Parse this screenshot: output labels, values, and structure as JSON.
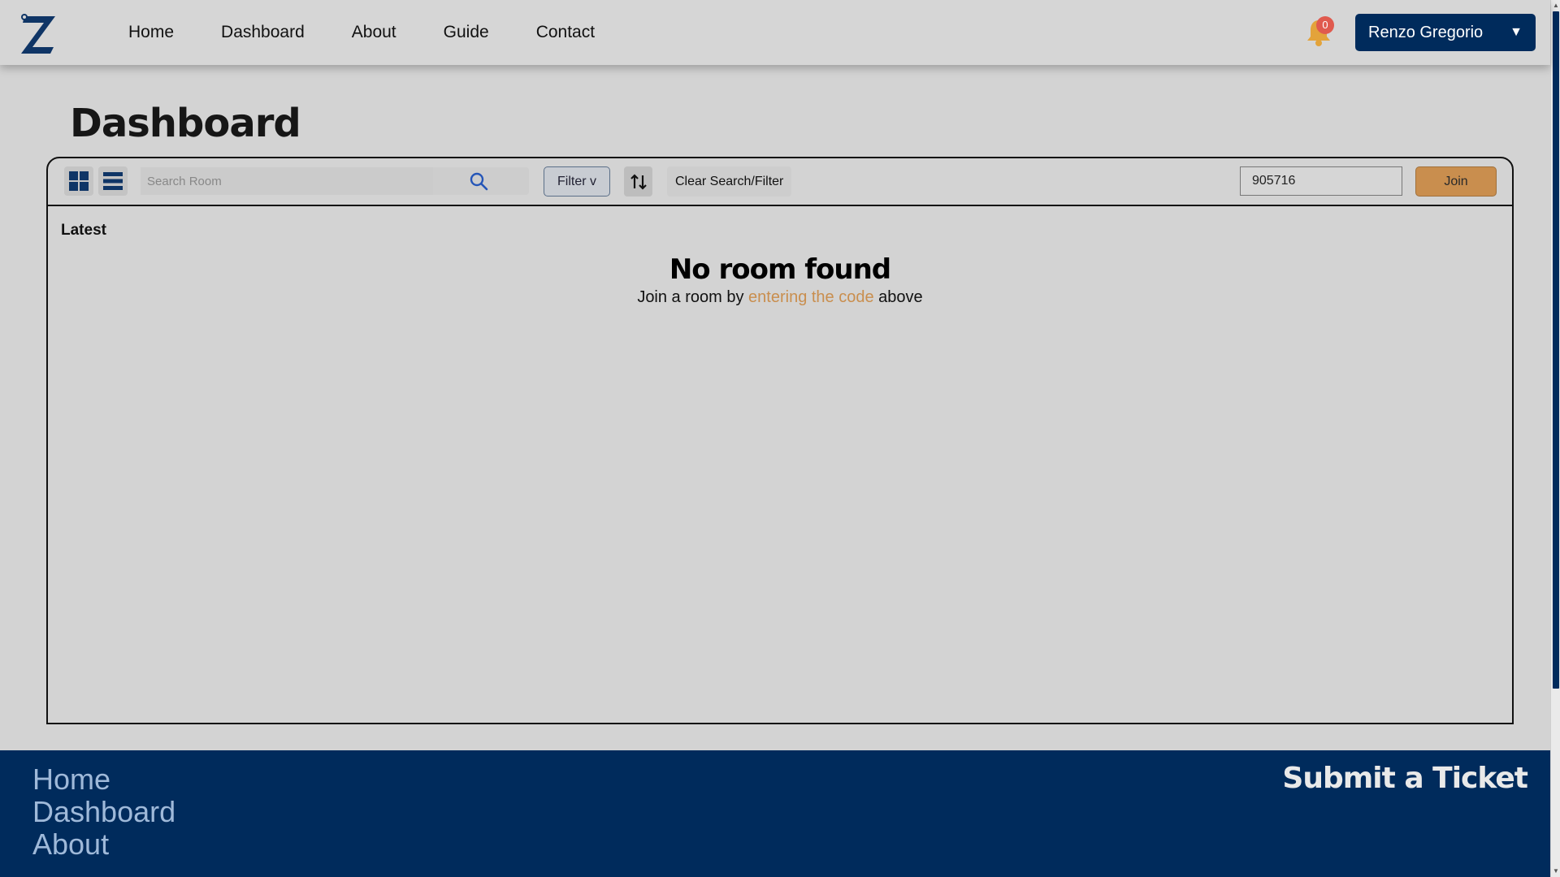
{
  "header": {
    "nav": [
      "Home",
      "Dashboard",
      "About",
      "Guide",
      "Contact"
    ],
    "notifications_count": "0",
    "user_name": "Renzo Gregorio",
    "user_caret": "▼"
  },
  "page": {
    "title": "Dashboard"
  },
  "toolbar": {
    "search_placeholder": "Search Room",
    "filter_label": "Filter v",
    "clear_label": "Clear Search/Filter",
    "room_code_value": "905716",
    "join_label": "Join"
  },
  "content": {
    "section_label": "Latest",
    "empty_title": "No room found",
    "empty_prefix": "Join a room by ",
    "empty_link": "entering the code",
    "empty_suffix": " above"
  },
  "footer": {
    "links": [
      "Home",
      "Dashboard",
      "About"
    ],
    "submit_ticket": "Submit a Ticket"
  },
  "colors": {
    "brand_navy": "#002b5c",
    "accent_orange": "#c98e4e",
    "badge_red": "#e05a4e",
    "background": "#d3d3d3"
  },
  "icons": [
    "logo-icon",
    "bell-icon",
    "grid-view-icon",
    "list-view-icon",
    "search-icon",
    "sort-icon",
    "dropdown-caret-icon"
  ]
}
